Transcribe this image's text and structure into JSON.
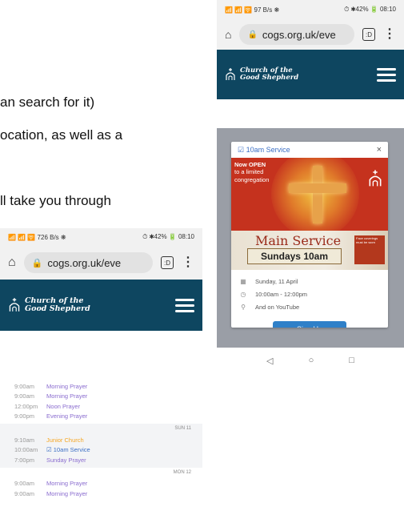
{
  "doc_text": {
    "line1": "an search for it)",
    "line2": "ocation, as well as a",
    "line3": "ll take you through"
  },
  "phone_right": {
    "status": {
      "left": "📶 📶 🛜 97 B/s ❋",
      "right": "⏱ ✱42% 🔋 08:10"
    },
    "address": {
      "url": "cogs.org.uk/eve",
      "tab_count": ":D"
    },
    "site": {
      "name_line1": "Church of the",
      "name_line2": "Good Shepherd",
      "logo_sub": "cogs"
    },
    "modal": {
      "title": "☑ 10am Service",
      "close": "×",
      "promo_line1": "Now OPEN",
      "promo_line2": "to a limited",
      "promo_line3": "congregation",
      "main_service": "Main Service",
      "sundays": "Sundays 10am",
      "face_note": "Face coverings must be worn",
      "date": "Sunday, 11 April",
      "time": "10:00am - 12:00pm",
      "location": "And on YouTube",
      "signup": "Sign Up"
    },
    "nav": {
      "back": "◁",
      "home": "○",
      "recent": "□"
    }
  },
  "phone_left": {
    "status": {
      "left": "📶 📶 🛜 726 B/s ❋",
      "right": "⏱ ✱42% 🔋 08:10"
    },
    "address": {
      "url": "cogs.org.uk/eve",
      "tab_count": ":D"
    },
    "site": {
      "name_line1": "Church of the",
      "name_line2": "Good Shepherd",
      "logo_sub": "cogs"
    },
    "events": {
      "day0": [
        {
          "time": "9:00am",
          "title": "Morning Prayer"
        },
        {
          "time": "9:00am",
          "title": "Morning Prayer"
        },
        {
          "time": "12:00pm",
          "title": "Noon Prayer"
        },
        {
          "time": "9:00pm",
          "title": "Evening Prayer"
        }
      ],
      "sun11_label": "SUN 11",
      "sun11": [
        {
          "time": "9:10am",
          "title": "Junior Church"
        },
        {
          "time": "10:00am",
          "title": "☑ 10am Service"
        },
        {
          "time": "7:00pm",
          "title": "Sunday Prayer"
        }
      ],
      "mon12_label": "MON 12",
      "mon12": [
        {
          "time": "9:00am",
          "title": "Morning Prayer"
        },
        {
          "time": "9:00am",
          "title": "Morning Prayer"
        }
      ]
    }
  },
  "colors": {
    "header": "#0e4660",
    "accent_blue": "#2f80c8",
    "event_purple": "#8a6ccf",
    "event_orange": "#f5a623"
  },
  "icons": [
    "home-icon",
    "lock-icon",
    "tabs-icon",
    "menu-dots-icon",
    "hamburger-icon",
    "church-logo-icon",
    "calendar-icon",
    "clock-icon",
    "location-icon",
    "close-icon"
  ]
}
